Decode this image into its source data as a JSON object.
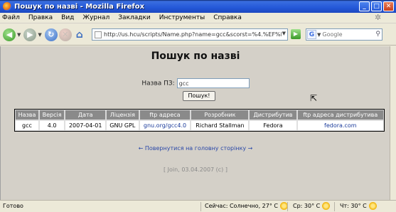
{
  "window": {
    "title": "Пошук по назві - Mozilla Firefox",
    "buttons": [
      "_",
      "□",
      "✕"
    ]
  },
  "menu": [
    "Файл",
    "Правка",
    "Вид",
    "Журнал",
    "Закладки",
    "Инструменты",
    "Справка"
  ],
  "navigation": {
    "url": "http://us.hcu/scripts/Name.php?name=gcc&scorst=%4.%EF%E8",
    "search_placeholder": "Google",
    "icons": [
      "back-arrow-icon",
      "forward-arrow-icon",
      "reload-icon",
      "stop-icon",
      "home-icon",
      "go-arrow-icon",
      "google-icon",
      "magnifier-icon"
    ]
  },
  "page": {
    "heading": "Пошук по назві",
    "form": {
      "label": "Назва ПЗ:",
      "value": "gcc",
      "submit": "Пошук!"
    },
    "table": {
      "headers": [
        "Назва",
        "Версія",
        "Дата",
        "Ліцензія",
        "ftp адреса",
        "Розробник",
        "Дистрибутив",
        "ftp адреса дистрибутива"
      ],
      "rows": [
        [
          "gcc",
          "4.0",
          "2007-04-01",
          "GNU GPL",
          "gnu.org/gcc4.0",
          "Richard Stallman",
          "Fedora",
          "fedora.com"
        ]
      ]
    },
    "back_link": "← Повернутися на головну сторінку →",
    "footer": "[ Join, 03.04.2007 (c) ]"
  },
  "status": {
    "left": "Готово",
    "weather": [
      {
        "label": "Сейчас: Солнечно, 27° C"
      },
      {
        "label": "Ср: 30° C"
      },
      {
        "label": "Чт: 30° C"
      }
    ]
  },
  "colors": {
    "titlebar": "#2458d8",
    "content_bg": "#d4d0c8",
    "table_header": "#8a8a8a",
    "link": "#1a3a9a"
  }
}
